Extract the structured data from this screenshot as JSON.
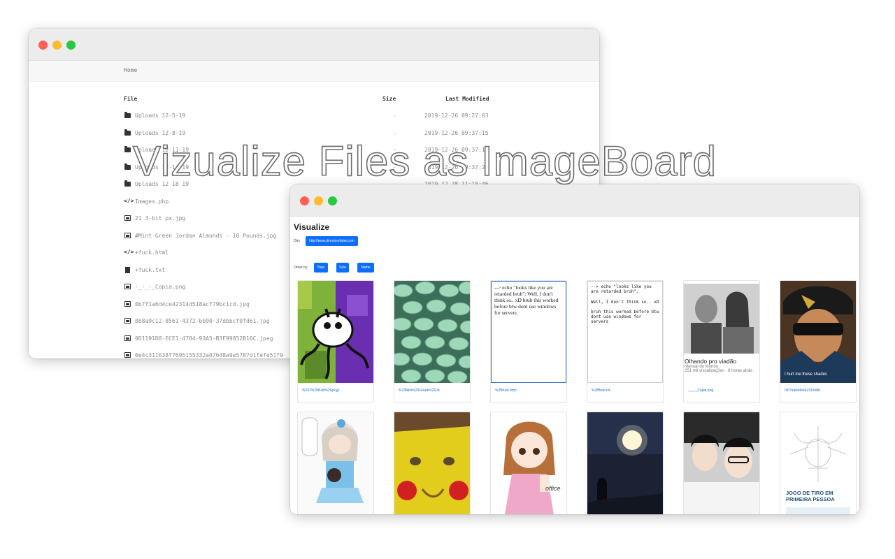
{
  "hero_title": "Vizualize Files as ImageBoard",
  "back_window": {
    "breadcrumb": "Home",
    "columns": {
      "file": "File",
      "size": "Size",
      "modified": "Last Modified"
    },
    "rows": [
      {
        "icon": "folder",
        "name": "Uploads 12-5-19",
        "size": "-",
        "date": "2019-12-26 09:27:03"
      },
      {
        "icon": "folder",
        "name": "Uploads 12-8-19",
        "size": "-",
        "date": "2019-12-26 09:37:15"
      },
      {
        "icon": "folder",
        "name": "Uploads 12-11-19",
        "size": "-",
        "date": "2019-12-26 09:37:18"
      },
      {
        "icon": "folder",
        "name": "Uploads 12-14-19",
        "size": "-",
        "date": "2019-12-26 09:37:22"
      },
      {
        "icon": "folder",
        "name": "Uploads 12 18 19",
        "size": "",
        "date": "2019 12 28 11:18:46"
      },
      {
        "icon": "code",
        "name": "Images.php",
        "size": "",
        "date": ""
      },
      {
        "icon": "image",
        "name": "21 3-bit px.jpg",
        "size": "",
        "date": ""
      },
      {
        "icon": "image",
        "name": "#Mint Green Jordan Almonds - 10 Pounds.jpg",
        "size": "",
        "date": ""
      },
      {
        "icon": "code",
        "name": "+fuck.html",
        "size": "",
        "date": ""
      },
      {
        "icon": "file",
        "name": "+fuck.txt",
        "size": "",
        "date": ""
      },
      {
        "icon": "image",
        "name": "-_-_-_Copia.png",
        "size": "",
        "date": ""
      },
      {
        "icon": "image",
        "name": "0b7f1a6d4ce42314d518acf79bc1cd.jpg",
        "size": "",
        "date": ""
      },
      {
        "icon": "image",
        "name": "0b8a9c12-8561-4372-bb90-37dbbcf0fd61.jpg",
        "size": "",
        "date": ""
      },
      {
        "icon": "image",
        "name": "0D1191D8-ECE1-4784-93A5-B3F99852B16C.jpeg",
        "size": "",
        "date": ""
      },
      {
        "icon": "image",
        "name": "0e4c311638f7695155332a07648a9e5787d1fefe51f9",
        "size": "",
        "date": ""
      }
    ]
  },
  "front_window": {
    "title": "Visualize",
    "dirs_label": "Dirs",
    "dir_button": "http://www.directorylister.com",
    "order_label": "Order by",
    "order_buttons": [
      "New",
      "Size",
      "Name"
    ],
    "cards": [
      {
        "caption": "%231%208-bit%20px.jp",
        "kind": "image"
      },
      {
        "caption": "%23Mint%20Green%20Jo",
        "kind": "image"
      },
      {
        "caption": "%2Bfuck.html",
        "kind": "text",
        "text": "--> echo \"looks like you are retarded bruh\"; Well, I don't think so.. xD bruh this worked before btw dont use windows for servers"
      },
      {
        "caption": "%2Bfuck.txt",
        "kind": "text",
        "text": "--> echo \"looks like you are retarded bruh\";\n\nWell, I don't think so.. xD\n\nbruh this worked before btw dont use windows for servers"
      },
      {
        "caption": "-_-_-_Copia.png",
        "kind": "image",
        "overlay_title": "Olhando pro viadão",
        "overlay_channel": "Manual do Mundo",
        "overlay_meta": "251 mil visualizações · 8 horas atrás"
      },
      {
        "caption": "0b7f1a6d4ce42314d4b",
        "kind": "image",
        "overlay_text": "I hurt me these shades"
      },
      {
        "caption": "",
        "kind": "image"
      },
      {
        "caption": "",
        "kind": "image"
      },
      {
        "caption": "",
        "kind": "image",
        "overlay_text": "office"
      },
      {
        "caption": "",
        "kind": "image"
      },
      {
        "caption": "",
        "kind": "image"
      },
      {
        "caption": "",
        "kind": "image",
        "overlay_text": "JOGO DE TIRO EM PRIMEIRA PESSOA"
      }
    ]
  },
  "colors": {
    "accent": "#0d6efd",
    "link": "#1a6bc8",
    "traffic_red": "#ff5f57",
    "traffic_yellow": "#febc2e",
    "traffic_green": "#28c840"
  }
}
